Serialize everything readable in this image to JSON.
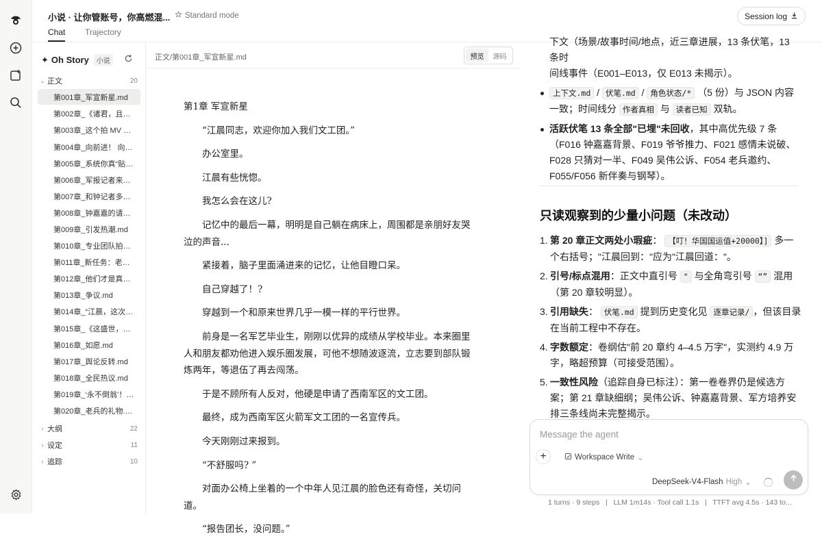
{
  "rail": {
    "icons": [
      "app-logo-icon",
      "new-chat-icon",
      "add-panel-icon",
      "search-icon",
      "settings-icon"
    ]
  },
  "header": {
    "title": "小说 · 让你管账号，你高燃混...",
    "mode": "Standard mode",
    "tabs": [
      {
        "label": "Chat"
      },
      {
        "label": "Trajectory"
      }
    ],
    "session_label": "Session log"
  },
  "sidebar": {
    "project_name": "Oh Story",
    "project_tag": "小说",
    "folders": [
      {
        "label": "正文",
        "count": "20"
      },
      {
        "label": "大纲",
        "count": "22"
      },
      {
        "label": "设定",
        "count": "11"
      },
      {
        "label": "追踪",
        "count": "10"
      }
    ],
    "files": [
      "第001章_军宣新星.md",
      "第002章_《诸君，且听...",
      "第003章_这个拍 MV 的...",
      "第004章_向前进！ 向前...",
      "第005章_系统你真“贴心...",
      "第006章_军报记者来采...",
      "第007章_和钟记者多联...",
      "第008章_钟嘉嘉的请求....",
      "第009章_引发热潮.md",
      "第010章_专业团队拍得...",
      "第011章_新任务：老兵...",
      "第012章_他们才是真正...",
      "第013章_争议.md",
      "第014章_“江晨，这次你...",
      "第015章_《这盛世，如...",
      "第016章_如愿.md",
      "第017章_舆论反转.md",
      "第018章_全民热议.md",
      "第019章_‘永不倒翁’！.md",
      "第020章_老兵的礼物.md"
    ]
  },
  "doc": {
    "path": "正文/第001章_军宣新星.md",
    "view_preview": "预览",
    "view_source": "源码",
    "heading": "第1章 军宣新星",
    "paragraphs": [
      "“江晨同志，欢迎你加入我们文工团。”",
      "办公室里。",
      "江晨有些恍惚。",
      "我怎么会在这儿?",
      "记忆中的最后一幕，明明是自己躺在病床上，周围都是亲朋好友哭泣的声音...",
      "紧接着，脑子里面涌进来的记忆，让他目瞪口呆。",
      "自己穿越了！?",
      "穿越到一个和原来世界几乎一模一样的平行世界。",
      "前身是一名军艺毕业生，刚刚以优异的成绩从学校毕业。本来圈里人和朋友都劝他进入娱乐圈发展，可他不想随波逐流，立志要到部队锻炼两年，等退伍了再去闯荡。",
      "于是不顾所有人反对，他硬是申请了西南军区的文工团。",
      "最终，成为西南军区火箭军文工团的一名宣传兵。",
      "今天刚刚过来报到。",
      "“不舒服吗? ”",
      "对面办公椅上坐着的一个中年人见江晨的脸色还有奇怪，关切问道。",
      "“报告团长，没问题。”"
    ]
  },
  "chat": {
    "top_line_1": "下文（场景/故事时间/地点，近三章进展，13 条伏笔，13 条时",
    "top_line_2": "间线事件（E001–E013，仅 E013 未揭示）。",
    "b1_code1": "上下文.md",
    "b1_sep1": "/",
    "b1_code2": "伏笔.md",
    "b1_sep2": "/",
    "b1_code3": "角色状态/*",
    "b1_text1": "（5 份）与 JSON 内容一致；时间线分",
    "b1_code4": "作者真相",
    "b1_and": "与",
    "b1_code5": "读者已知",
    "b1_text2": "双轨。",
    "b2_bold": "活跃伏笔 13 条全部\"已埋\"未回收",
    "b2_text": "，其中高优先级 7 条（F016 钟嘉嘉背景、F019 爷爷推力、F021 感情未说破、F028 只猜对一半、F049 吴伟公诉、F054 老兵邀约、F055/F056 新伴奏与钢琴）。",
    "section_title": "只读观察到的少量小问题（未改动）",
    "items": [
      {
        "n": "1.",
        "bold": "第 20 章正文两处小瑕疵",
        "pre": "：",
        "code": "【叮！华国国运值+20000】]",
        "post": "多一个右括号；\"江晨回到：\"应为\"江晨回道：\"。"
      },
      {
        "n": "2.",
        "bold": "引号/标点混用",
        "pre": "：正文中直引号",
        "code": "\"",
        "mid": "与全角弯引号",
        "code2": "“”",
        "post": "混用（第 20 章较明显）。"
      },
      {
        "n": "3.",
        "bold": "引用缺失",
        "pre": "：",
        "code": "伏笔.md",
        "mid": "提到历史变化见",
        "code2": "逐章记录/",
        "post": "，但该目录在当前工程中不存在。"
      },
      {
        "n": "4.",
        "bold": "字数额定",
        "pre": "：卷纲估\"前 20 章约 4–4.5 万字\"，实测约 4.9 万字，略超预算（可接受范围）。"
      },
      {
        "n": "5.",
        "bold": "一致性风险",
        "pre": "（追踪自身已标注）：第一卷卷界仍是候选方案；第 21 章缺细纲；吴伟公诉、钟嘉嘉背景、军方培养安排三条线尚未完整揭示。"
      }
    ],
    "composer": {
      "placeholder": "Message the agent",
      "workspace": "Workspace Write",
      "model": "DeepSeek-V4-Flash",
      "effort": "High"
    },
    "stats": "1 turns · 9 steps   |   LLM 1m14s · Tool call 1.1s   |   TTFT avg 4.5s · 143 to..."
  }
}
